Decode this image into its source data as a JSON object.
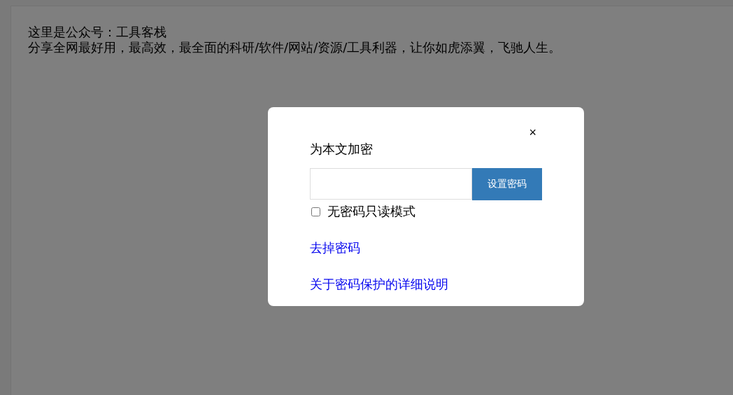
{
  "page": {
    "lines": [
      "这里是公众号：工具客栈",
      "分享全网最好用，最高效，最全面的科研/软件/网站/资源/工具利器，让你如虎添翼，飞驰人生。"
    ]
  },
  "dialog": {
    "close": "×",
    "title": "为本文加密",
    "button": "设置密码",
    "checkbox": {
      "label": "无密码只读模式",
      "checked": false
    },
    "links": [
      "去掉密码",
      "关于密码保护的详细说明"
    ]
  }
}
